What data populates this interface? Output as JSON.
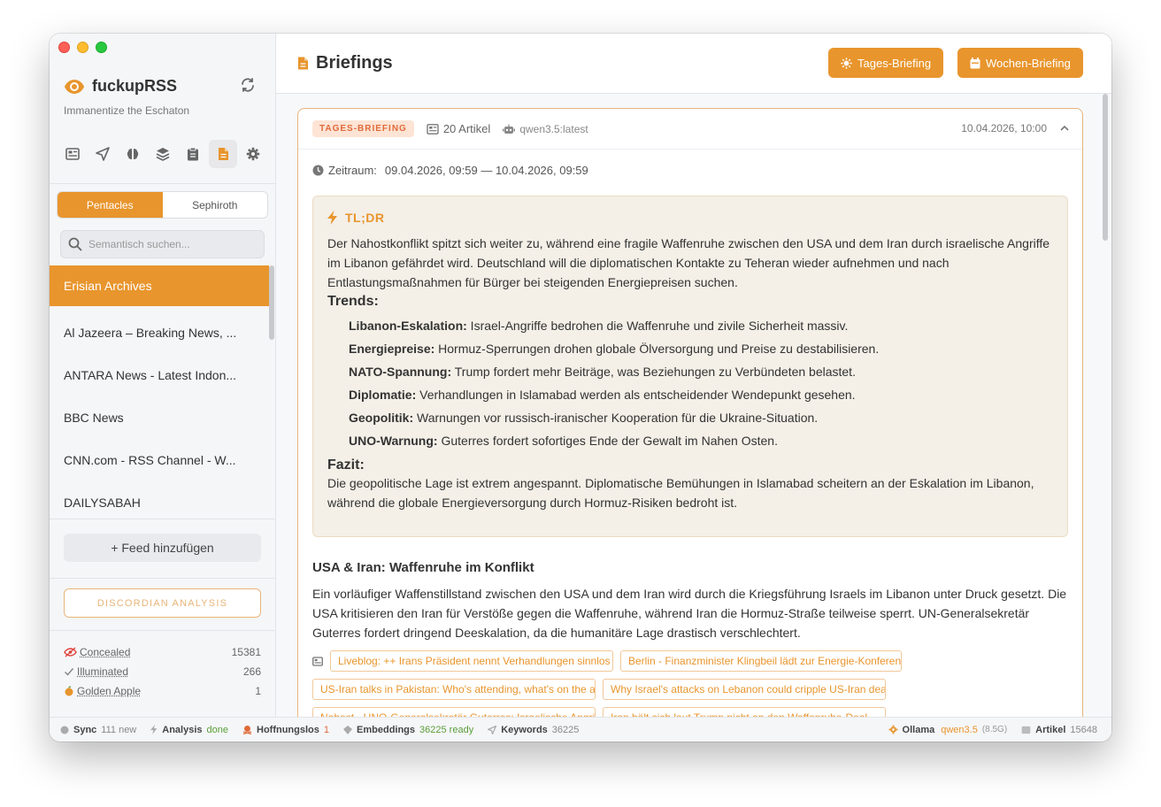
{
  "sidebar": {
    "app_name": "fuckupRSS",
    "tagline": "Immanentize the Eschaton",
    "tabs": [
      "Pentacles",
      "Sephiroth"
    ],
    "search_placeholder": "Semantisch suchen...",
    "feeds": [
      "Erisian Archives",
      "Al Jazeera – Breaking News, ...",
      "ANTARA News - Latest Indon...",
      "BBC News",
      "CNN.com - RSS Channel - W...",
      "DAILYSABAH"
    ],
    "add_feed": "+ Feed hinzufügen",
    "analysis_button": "DISCORDIAN ANALYSIS",
    "stats": [
      {
        "label": "Concealed",
        "value": "15381"
      },
      {
        "label": "Illuminated",
        "value": "266"
      },
      {
        "label": "Golden Apple",
        "value": "1"
      }
    ]
  },
  "header": {
    "title": "Briefings",
    "daily_button": "Tages-Briefing",
    "weekly_button": "Wochen-Briefing"
  },
  "briefing": {
    "badge": "TAGES-BRIEFING",
    "article_count": "20 Artikel",
    "model": "qwen3.5:latest",
    "timestamp": "10.04.2026, 10:00",
    "period_label": "Zeitraum:",
    "period": "09.04.2026, 09:59 — 10.04.2026, 09:59",
    "tldr_title": "TL;DR",
    "tldr_text": "Der Nahostkonflikt spitzt sich weiter zu, während eine fragile Waffenruhe zwischen den USA und dem Iran durch israelische Angriffe im Libanon gefährdet wird. Deutschland will die diplomatischen Kontakte zu Teheran wieder aufnehmen und nach Entlastungsmaßnahmen für Bürger bei steigenden Energiepreisen suchen.",
    "trends_title": "Trends:",
    "trends": [
      {
        "key": "Libanon-Eskalation:",
        "text": " Israel-Angriffe bedrohen die Waffenruhe und zivile Sicherheit massiv."
      },
      {
        "key": "Energiepreise:",
        "text": " Hormuz-Sperrungen drohen globale Ölversorgung und Preise zu destabilisieren."
      },
      {
        "key": "NATO-Spannung:",
        "text": " Trump fordert mehr Beiträge, was Beziehungen zu Verbündeten belastet."
      },
      {
        "key": "Diplomatie:",
        "text": " Verhandlungen in Islamabad werden als entscheidender Wendepunkt gesehen."
      },
      {
        "key": "Geopolitik:",
        "text": " Warnungen vor russisch-iranischer Kooperation für die Ukraine-Situation."
      },
      {
        "key": "UNO-Warnung:",
        "text": " Guterres fordert sofortiges Ende der Gewalt im Nahen Osten."
      }
    ],
    "conclusion_title": "Fazit:",
    "conclusion_text": "Die geopolitische Lage ist extrem angespannt. Diplomatische Bemühungen in Islamabad scheitern an der Eskalation im Libanon, während die globale Energieversorgung durch Hormuz-Risiken bedroht ist.",
    "section_title": "USA & Iran: Waffenruhe im Konflikt",
    "section_text": "Ein vorläufiger Waffenstillstand zwischen den USA und dem Iran wird durch die Kriegsführung Israels im Libanon unter Druck gesetzt. Die USA kritisieren den Iran für Verstöße gegen die Waffenruhe, während Iran die Hormuz-Straße teilweise sperrt. UN-Generalsekretär Guterres fordert dringend Deeskalation, da die humanitäre Lage drastisch verschlechtert.",
    "links": [
      "Liveblog: ++ Irans Präsident nennt Verhandlungen sinnlos ++",
      "Berlin - Finanzminister Klingbeil lädt zur Energie-Konferenz",
      "US-Iran talks in Pakistan: Who's attending, what's on the agenda",
      "Why Israel's attacks on Lebanon could cripple US-Iran deal",
      "Nahost - UNO-Generalsekretär Guterres: Israelische Angriffe",
      "Iran hält sich laut Trump nicht an den Waffenruhe-Deal"
    ]
  },
  "statusbar": {
    "sync_label": "Sync",
    "sync_value": "111 new",
    "analysis_label": "Analysis",
    "analysis_value": "done",
    "hope_label": "Hoffnungslos",
    "hope_value": "1",
    "emb_label": "Embeddings",
    "emb_value": "36225 ready",
    "kw_label": "Keywords",
    "kw_value": "36225",
    "ollama_label": "Ollama",
    "ollama_model": "qwen3.5",
    "ollama_size": "(8.5G)",
    "articles_label": "Artikel",
    "articles_value": "15648"
  },
  "colors": {
    "accent": "#e8952d",
    "badge_text": "#e06a3a",
    "ok_green": "#5a9e3a"
  }
}
